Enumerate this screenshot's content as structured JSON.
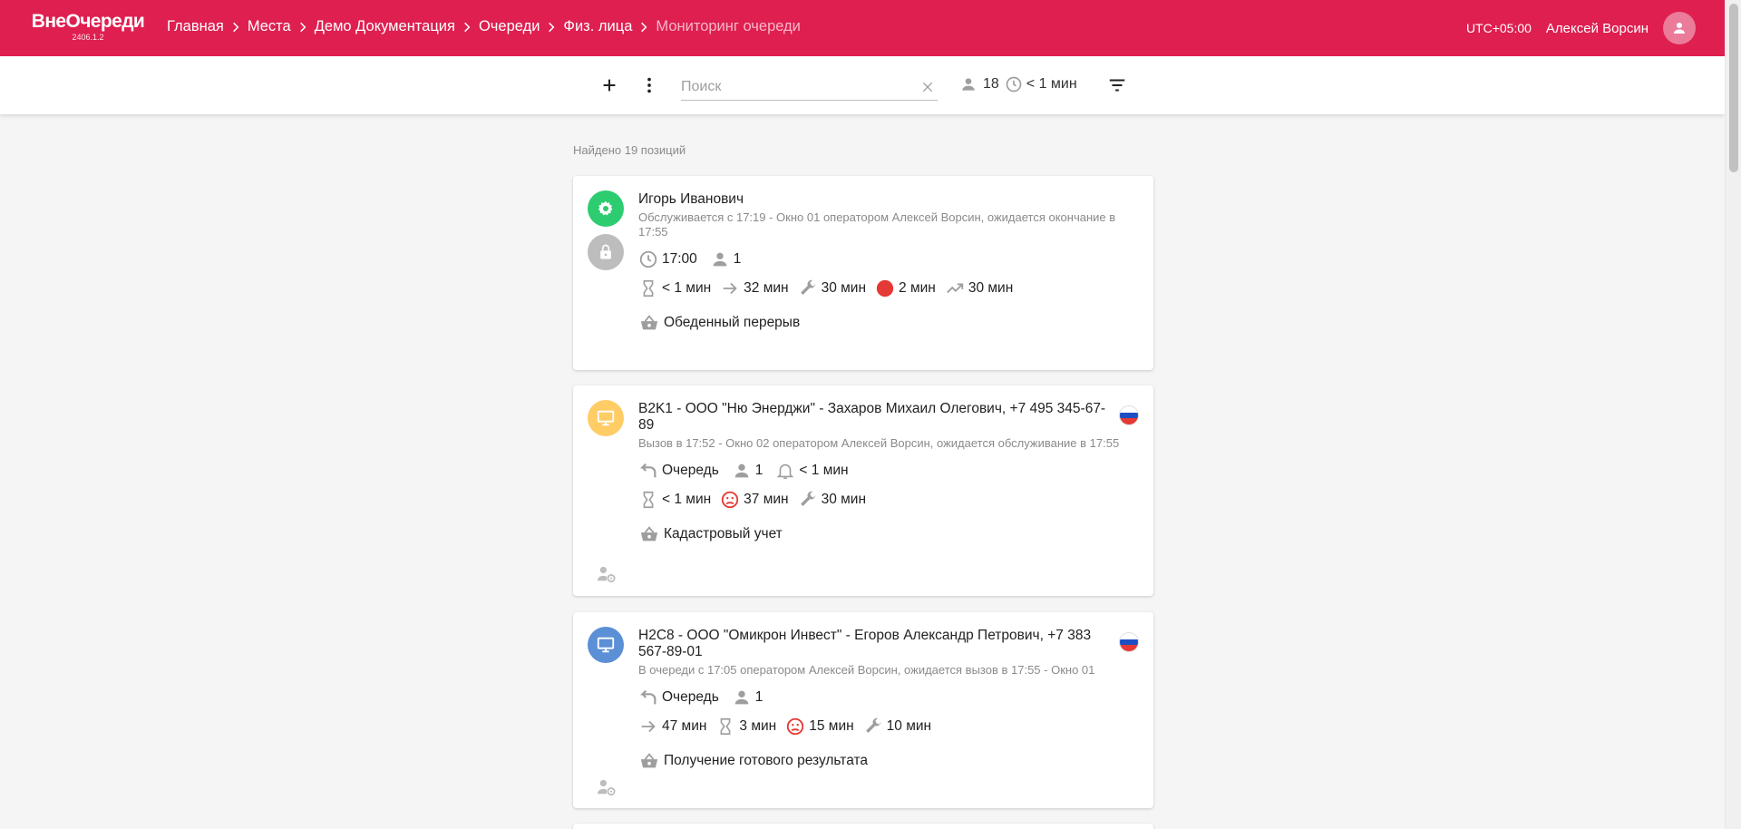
{
  "app": {
    "name": "ВнеОчереди",
    "version": "2406.1.2"
  },
  "breadcrumbs": [
    {
      "label": "Главная"
    },
    {
      "label": "Места"
    },
    {
      "label": "Демо Документация"
    },
    {
      "label": "Очереди"
    },
    {
      "label": "Физ. лица"
    },
    {
      "label": "Мониторинг очереди"
    }
  ],
  "header": {
    "timezone": "UTC+05:00",
    "user": "Алексей Ворсин"
  },
  "toolbar": {
    "search_placeholder": "Поиск",
    "search_value": "",
    "people_count": "18",
    "wait_time": "< 1 мин"
  },
  "found_text": "Найдено 19 позиций",
  "colors": {
    "brand": "#de1f50",
    "serving": "#2ecc71",
    "called": "#ffcc66",
    "waiting": "#5b8fd6",
    "red": "#e53935"
  },
  "cards": [
    {
      "title": "Игорь Иванович",
      "subtitle": "Обслуживается с 17:19 - Окно 01 оператором Алексей Ворсин, ожидается окончание в 17:55",
      "status_icon": "gear-icon",
      "row1": {
        "time": "17:00",
        "persons": "1"
      },
      "row2": {
        "wait": "< 1 мин",
        "arrow": "32 мин",
        "service": "30 мин",
        "red": "2 мин",
        "trend": "30 мин"
      },
      "service_name": "Обеденный перерыв"
    },
    {
      "title": "B2K1 - ООО \"Ню Энерджи\" - Захаров Михаил Олегович, +7 495 345-67-89",
      "subtitle": "Вызов в 17:52 - Окно 02 оператором Алексей Ворсин, ожидается обслуживание в 17:55",
      "status_icon": "monitor-icon",
      "row1": {
        "queue": "Очередь",
        "persons": "1",
        "bell": "< 1 мин"
      },
      "row2": {
        "wait": "< 1 мин",
        "sad": "37 мин",
        "service": "30 мин"
      },
      "service_name": "Кадастровый учет"
    },
    {
      "title": "H2C8 - ООО \"Омикрон Инвест\" - Егоров Александр Петрович, +7 383 567-89-01",
      "subtitle": "В очереди с 17:05 оператором Алексей Ворсин, ожидается вызов в 17:55 - Окно 01",
      "status_icon": "monitor-icon",
      "row1": {
        "queue": "Очередь",
        "persons": "1"
      },
      "row2": {
        "arrow": "47 мин",
        "wait": "3 мин",
        "sad": "15 мин",
        "service": "10 мин"
      },
      "service_name": "Получение готового результата"
    }
  ]
}
